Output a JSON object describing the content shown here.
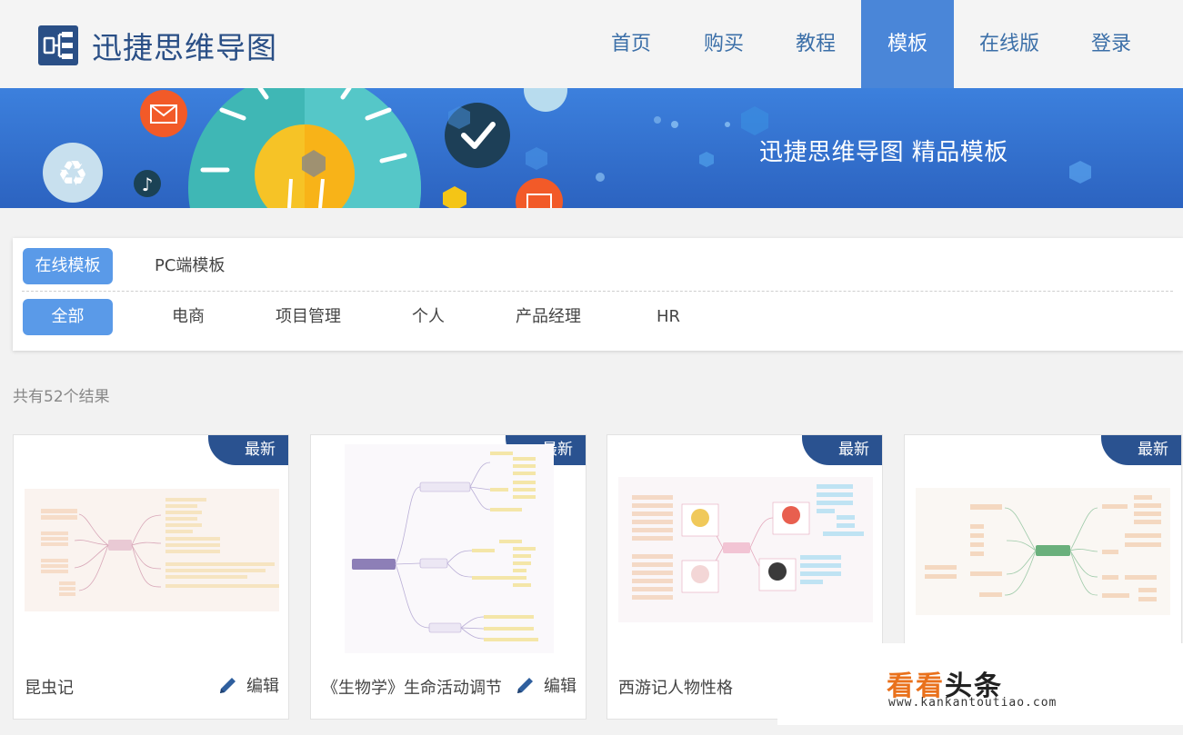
{
  "header": {
    "logo_text": "迅捷思维导图",
    "nav": [
      {
        "label": "首页"
      },
      {
        "label": "购买"
      },
      {
        "label": "教程"
      },
      {
        "label": "模板",
        "active": true
      },
      {
        "label": "在线版"
      },
      {
        "label": "登录"
      }
    ]
  },
  "banner": {
    "title": "迅捷思维导图 精品模板"
  },
  "filter": {
    "source_tabs": [
      "在线模板",
      "PC端模板"
    ],
    "categories": [
      "全部",
      "电商",
      "项目管理",
      "个人",
      "产品经理",
      "HR"
    ]
  },
  "results": {
    "count_text": "共有52个结果"
  },
  "cards": [
    {
      "title": "昆虫记",
      "badge": "最新",
      "edit_label": "编辑"
    },
    {
      "title": "《生物学》生命活动调节",
      "badge": "最新",
      "edit_label": "编辑"
    },
    {
      "title": "西游记人物性格",
      "badge": "最新"
    },
    {
      "badge": "最新"
    }
  ],
  "watermark": {
    "brand_orange": "看看",
    "brand_dark": "头条",
    "url": "www.kankantoutiao.com"
  },
  "colors": {
    "brand": "#2a4f86",
    "nav_active": "#4a86d8",
    "pill_active": "#5a9ae8",
    "badge": "#2a5290"
  }
}
